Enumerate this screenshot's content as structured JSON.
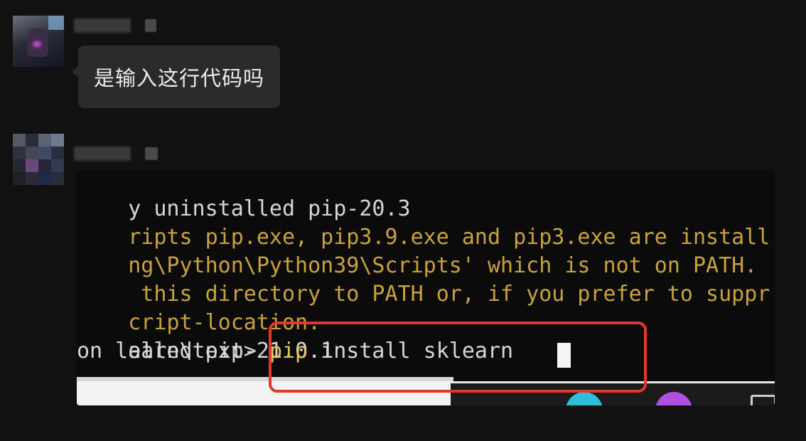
{
  "messages": [
    {
      "text": "是输入这行代码吗"
    },
    {
      "terminal": {
        "lines": [
          {
            "segments": [
              {
                "text": "y uninstalled pip-20.3",
                "color": "white"
              }
            ]
          },
          {
            "segments": [
              {
                "text": "ripts pip.exe, pip3.9.exe and pip3.exe are install",
                "color": "yellow"
              }
            ]
          },
          {
            "segments": [
              {
                "text": "ng\\Python\\Python39\\Scripts' which is not on PATH.",
                "color": "yellow"
              }
            ]
          },
          {
            "segments": [
              {
                "text": " this directory to PATH or, if you prefer to suppr",
                "color": "yellow"
              }
            ]
          },
          {
            "segments": [
              {
                "text": "cript-location.",
                "color": "yellow"
              }
            ]
          },
          {
            "segments": [
              {
                "text": "alled pip-21.0.1",
                "color": "white"
              }
            ]
          },
          {
            "segments": [
              {
                "text": "on learn\\text> ",
                "color": "white"
              },
              {
                "text": "pip",
                "color": "pip"
              },
              {
                "text": " install sklearn",
                "color": "white"
              }
            ]
          }
        ]
      }
    }
  ],
  "colors": {
    "background": "#111111",
    "bubble": "#2b2b2b",
    "terminal_yellow": "#c9a23a",
    "highlight_box": "#e0382c"
  }
}
